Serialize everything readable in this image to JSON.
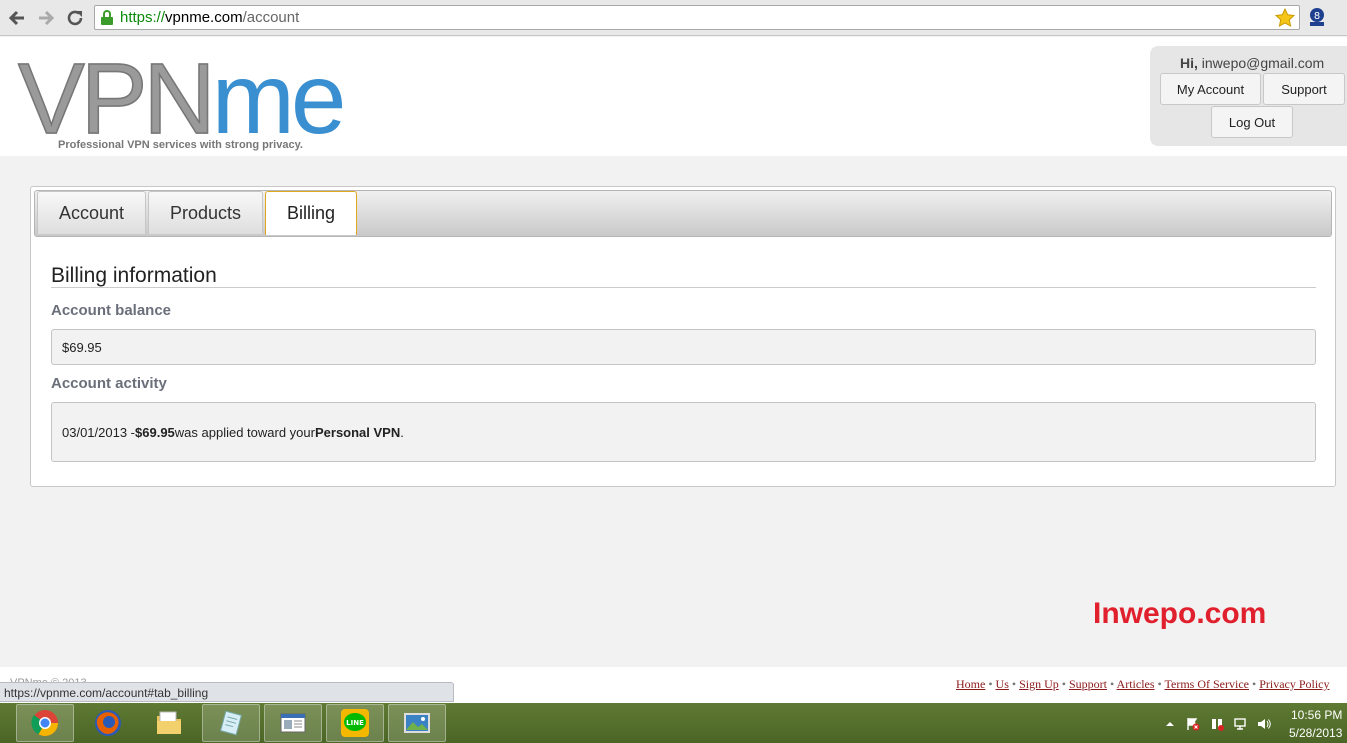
{
  "browser": {
    "url_scheme": "https://",
    "url_host": "vpnme.com",
    "url_path": "/account",
    "status_url": "https://vpnme.com/account#tab_billing"
  },
  "header": {
    "logo_vpn": "VPN",
    "logo_me": "me",
    "tagline": "Professional VPN services with strong privacy.",
    "greeting_prefix": "Hi,",
    "user_email": "inwepo@gmail.com",
    "my_account_label": "My Account",
    "support_label": "Support",
    "logout_label": "Log Out"
  },
  "tabs": [
    {
      "label": "Account",
      "active": false
    },
    {
      "label": "Products",
      "active": false
    },
    {
      "label": "Billing",
      "active": true
    }
  ],
  "billing": {
    "title": "Billing information",
    "balance_label": "Account balance",
    "balance_value": "$69.95",
    "activity_label": "Account activity",
    "activity": {
      "date": "03/01/2013 - ",
      "amount": "$69.95",
      "middle": " was applied toward your ",
      "product": "Personal VPN",
      "end": "."
    }
  },
  "watermark": "Inwepo.com",
  "footer": {
    "copyright": "VPNme © 2013",
    "links": [
      "Home",
      "Us",
      "Sign Up",
      "Support",
      "Articles",
      "Terms Of Service",
      "Privacy Policy"
    ],
    "separator": " • "
  },
  "taskbar": {
    "apps": [
      "chrome",
      "firefox",
      "file-explorer",
      "notepad",
      "news-app",
      "line",
      "photo-viewer"
    ],
    "time": "10:56 PM",
    "date": "5/28/2013"
  },
  "colors": {
    "accent_blue": "#3a8fd1",
    "active_tab_border": "#e0a820",
    "watermark_red": "#e0202c",
    "footer_link": "#8b1a1a",
    "taskbar_green": "#5f7a33"
  }
}
